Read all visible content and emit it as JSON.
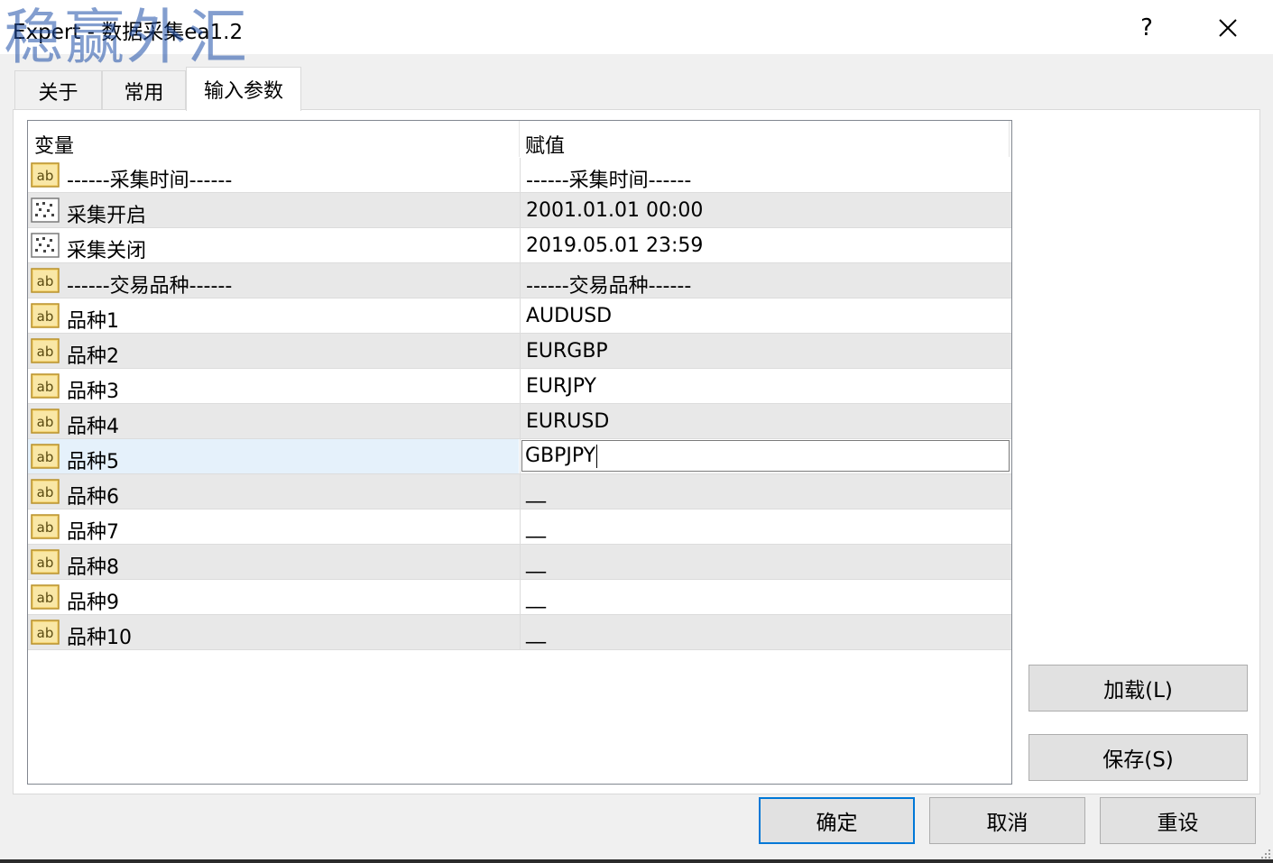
{
  "window": {
    "title": "Expert - 数据采集ea1.2",
    "watermark": "稳赢外汇",
    "help_label": "?",
    "close_icon": "close-icon"
  },
  "tabs": [
    {
      "label": "关于",
      "active": false
    },
    {
      "label": "常用",
      "active": false
    },
    {
      "label": "输入参数",
      "active": true
    }
  ],
  "grid": {
    "headers": [
      "变量",
      "赋值"
    ],
    "rows": [
      {
        "icon": "string-param-icon",
        "name": "------采集时间------",
        "value": "------采集时间------"
      },
      {
        "icon": "datetime-param-icon",
        "name": "采集开启",
        "value": "2001.01.01 00:00"
      },
      {
        "icon": "datetime-param-icon",
        "name": "采集关闭",
        "value": "2019.05.01 23:59"
      },
      {
        "icon": "string-param-icon",
        "name": "------交易品种------",
        "value": "------交易品种------"
      },
      {
        "icon": "string-param-icon",
        "name": "品种1",
        "value": "AUDUSD"
      },
      {
        "icon": "string-param-icon",
        "name": "品种2",
        "value": "EURGBP"
      },
      {
        "icon": "string-param-icon",
        "name": "品种3",
        "value": "EURJPY"
      },
      {
        "icon": "string-param-icon",
        "name": "品种4",
        "value": "EURUSD"
      },
      {
        "icon": "string-param-icon",
        "name": "品种5",
        "value": "GBPJPY",
        "editing": true
      },
      {
        "icon": "string-param-icon",
        "name": "品种6",
        "value": "__"
      },
      {
        "icon": "string-param-icon",
        "name": "品种7",
        "value": "__"
      },
      {
        "icon": "string-param-icon",
        "name": "品种8",
        "value": "__"
      },
      {
        "icon": "string-param-icon",
        "name": "品种9",
        "value": "__"
      },
      {
        "icon": "string-param-icon",
        "name": "品种10",
        "value": "__"
      }
    ]
  },
  "side_buttons": {
    "load": "加载(L)",
    "save": "保存(S)"
  },
  "footer_buttons": {
    "ok": "确定",
    "cancel": "取消",
    "reset": "重设"
  },
  "colors": {
    "accent": "#0078d7",
    "alt_row": "#e8e8e8",
    "selected_row": "#e5f1fb",
    "icon_fill": "#f5d77a"
  }
}
